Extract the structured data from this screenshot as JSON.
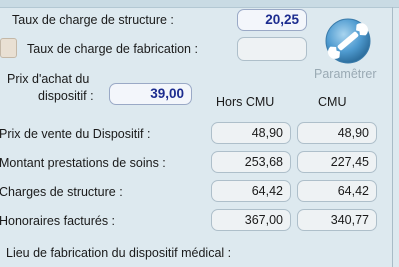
{
  "structure": {
    "label": "Taux de charge de structure :",
    "value": "20,25"
  },
  "fabrication": {
    "label": "Taux de charge de fabrication :",
    "value": ""
  },
  "purchase": {
    "label_line1": "Prix d'achat du",
    "label_line2": "dispositif :",
    "value": "39,00"
  },
  "settings": {
    "label": "Paramêtrer",
    "icon": "wrench-icon"
  },
  "columns": {
    "hors_cmu": "Hors CMU",
    "cmu": "CMU"
  },
  "rows": [
    {
      "label": "Prix de vente du Dispositif :",
      "hors_cmu": "48,90",
      "cmu": "48,90"
    },
    {
      "label": "Montant prestations de soins :",
      "hors_cmu": "253,68",
      "cmu": "227,45"
    },
    {
      "label": "Charges de structure :",
      "hors_cmu": "64,42",
      "cmu": "64,42"
    },
    {
      "label": "Honoraires facturés :",
      "hors_cmu": "367,00",
      "cmu": "340,77"
    }
  ],
  "manufacturing_place": {
    "label": "Lieu de fabrication du dispositif médical :"
  },
  "colors": {
    "background": "#dde9ef",
    "value_highlight": "#1c2c8f",
    "icon_blue": "#4f9bd0"
  }
}
